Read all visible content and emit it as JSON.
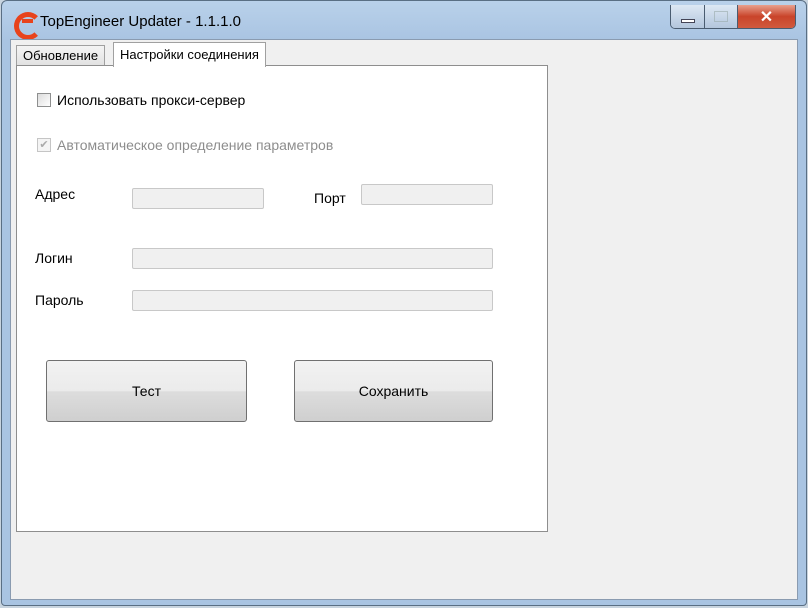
{
  "window": {
    "title": "TopEngineer Updater - 1.1.1.0"
  },
  "tabs": [
    {
      "label": "Обновление"
    },
    {
      "label": "Настройки соединения",
      "active": true
    }
  ],
  "settings": {
    "use_proxy": {
      "label": "Использовать прокси-сервер",
      "checked": false
    },
    "auto_detect": {
      "label": "Автоматическое определение параметров",
      "checked": true,
      "disabled": true
    },
    "address_label": "Адрес",
    "address_value": "",
    "port_label": "Порт",
    "port_value": "",
    "login_label": "Логин",
    "login_value": "",
    "password_label": "Пароль",
    "password_value": "",
    "test_button": "Тест",
    "save_button": "Сохранить"
  }
}
